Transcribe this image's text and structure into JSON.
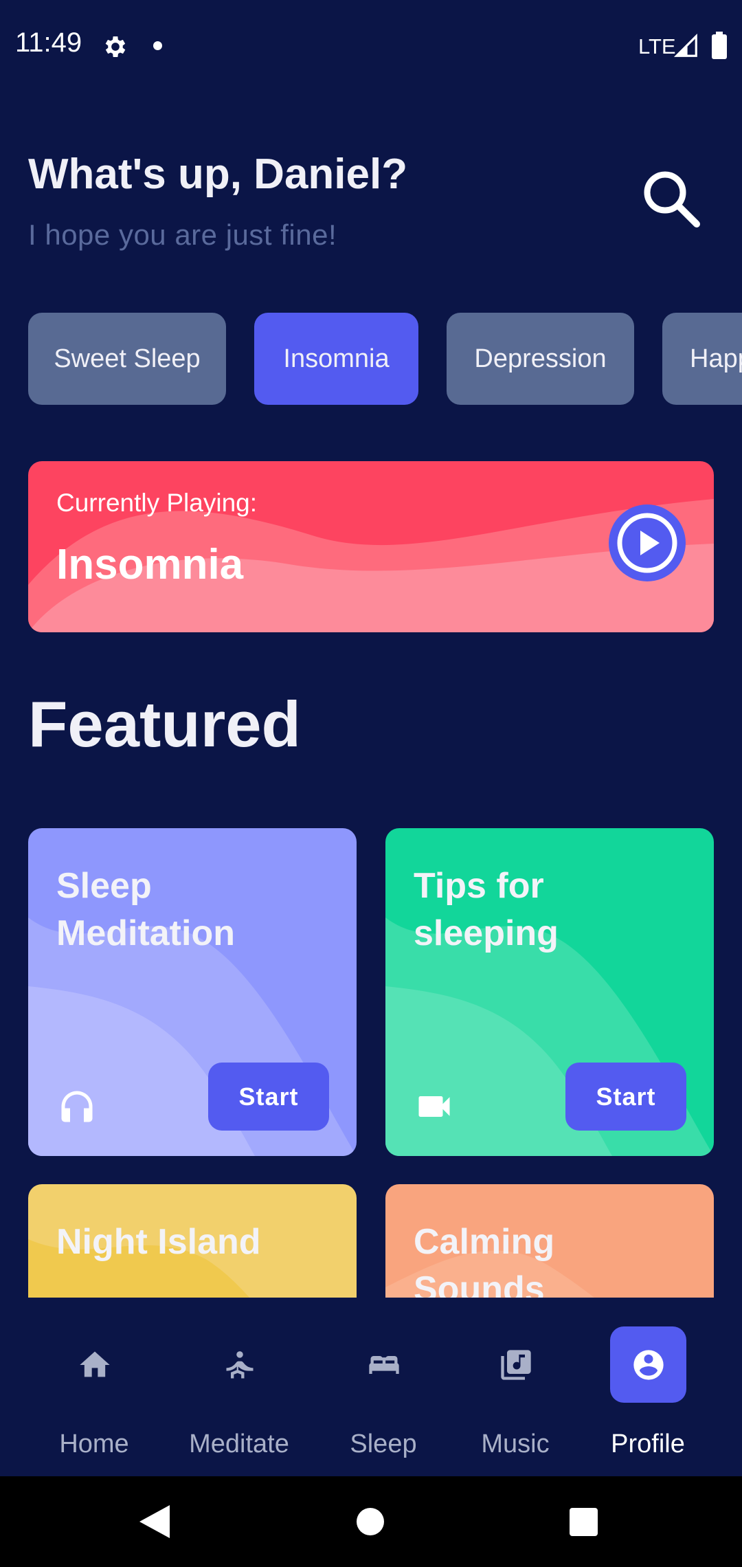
{
  "status_bar": {
    "time": "11:49",
    "network": "LTE",
    "icons": [
      "gear-icon",
      "notification-dot-icon",
      "signal-icon",
      "battery-icon"
    ]
  },
  "header": {
    "greeting": "What's up, Daniel?",
    "subtitle": "I hope you are just fine!",
    "search_icon": "search-icon"
  },
  "chips": [
    {
      "label": "Sweet Sleep",
      "selected": false
    },
    {
      "label": "Insomnia",
      "selected": true
    },
    {
      "label": "Depression",
      "selected": false
    },
    {
      "label": "Happ",
      "selected": false
    }
  ],
  "now_playing": {
    "label": "Currently Playing:",
    "title": "Insomnia",
    "play_icon": "play-circle-icon"
  },
  "featured": {
    "title": "Featured",
    "cards": [
      {
        "title": "Sleep Meditation",
        "icon": "headphones-icon",
        "button": "Start"
      },
      {
        "title": "Tips for sleeping",
        "icon": "videocam-icon",
        "button": "Start"
      },
      {
        "title": "Night Island",
        "icon": "",
        "button": ""
      },
      {
        "title": "Calming Sounds",
        "icon": "",
        "button": ""
      }
    ]
  },
  "bottom_nav": [
    {
      "label": "Home",
      "icon": "home-icon",
      "active": false
    },
    {
      "label": "Meditate",
      "icon": "meditate-icon",
      "active": false
    },
    {
      "label": "Sleep",
      "icon": "bed-icon",
      "active": false
    },
    {
      "label": "Music",
      "icon": "music-library-icon",
      "active": false
    },
    {
      "label": "Profile",
      "icon": "profile-icon",
      "active": true
    }
  ],
  "colors": {
    "background": "#0b1547",
    "accent": "#535bf0",
    "chip_inactive": "#586a93",
    "now_playing": "#fd4460",
    "card_meditation": "#8e97fd",
    "card_tips": "#12d69a",
    "card_night_island": "#f2d06c",
    "card_calming": "#f9a47e"
  }
}
